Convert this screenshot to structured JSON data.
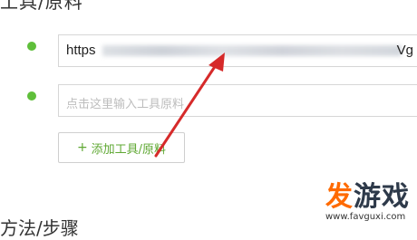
{
  "section": {
    "title": "工具/原料"
  },
  "tools": [
    {
      "value_start": "https",
      "value_end": "Vg"
    },
    {
      "placeholder": "点击这里输入工具原料"
    }
  ],
  "add_button": {
    "icon": "+",
    "label": "添加工具/原料"
  },
  "next_section": {
    "title": "方法/步骤"
  },
  "colors": {
    "accent_green": "#5fbf3a",
    "arrow_red": "#d62a2a",
    "watermark_orange": "#ff6a00"
  },
  "watermark": {
    "brand_part1": "发",
    "brand_part2": "游戏",
    "url": "www.favguxi.com"
  }
}
